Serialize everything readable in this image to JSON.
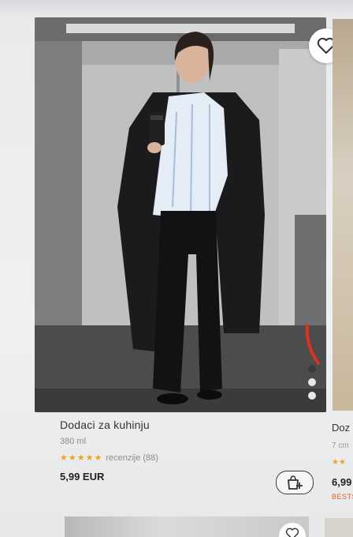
{
  "product": {
    "title": "Dodaci za kuhinju",
    "subtitle": "380 ml",
    "stars": "★★★★★",
    "reviews_label": "recenzije",
    "reviews_count": "(88)",
    "price": "5,99 EUR",
    "wishlist_icon": "heart-icon",
    "cart_icon": "shopping-bag-plus-icon",
    "carousel": {
      "total_dots": 3,
      "active_index": 0
    }
  },
  "next_product": {
    "title_partial": "Doz",
    "subtitle_partial": "7 cm",
    "stars_partial": "★★",
    "price_partial": "6,99",
    "badge_partial": "BESTS"
  },
  "colors": {
    "star": "#f3a21a",
    "badge": "#e85a2a",
    "accent_mark": "#e0311f"
  }
}
